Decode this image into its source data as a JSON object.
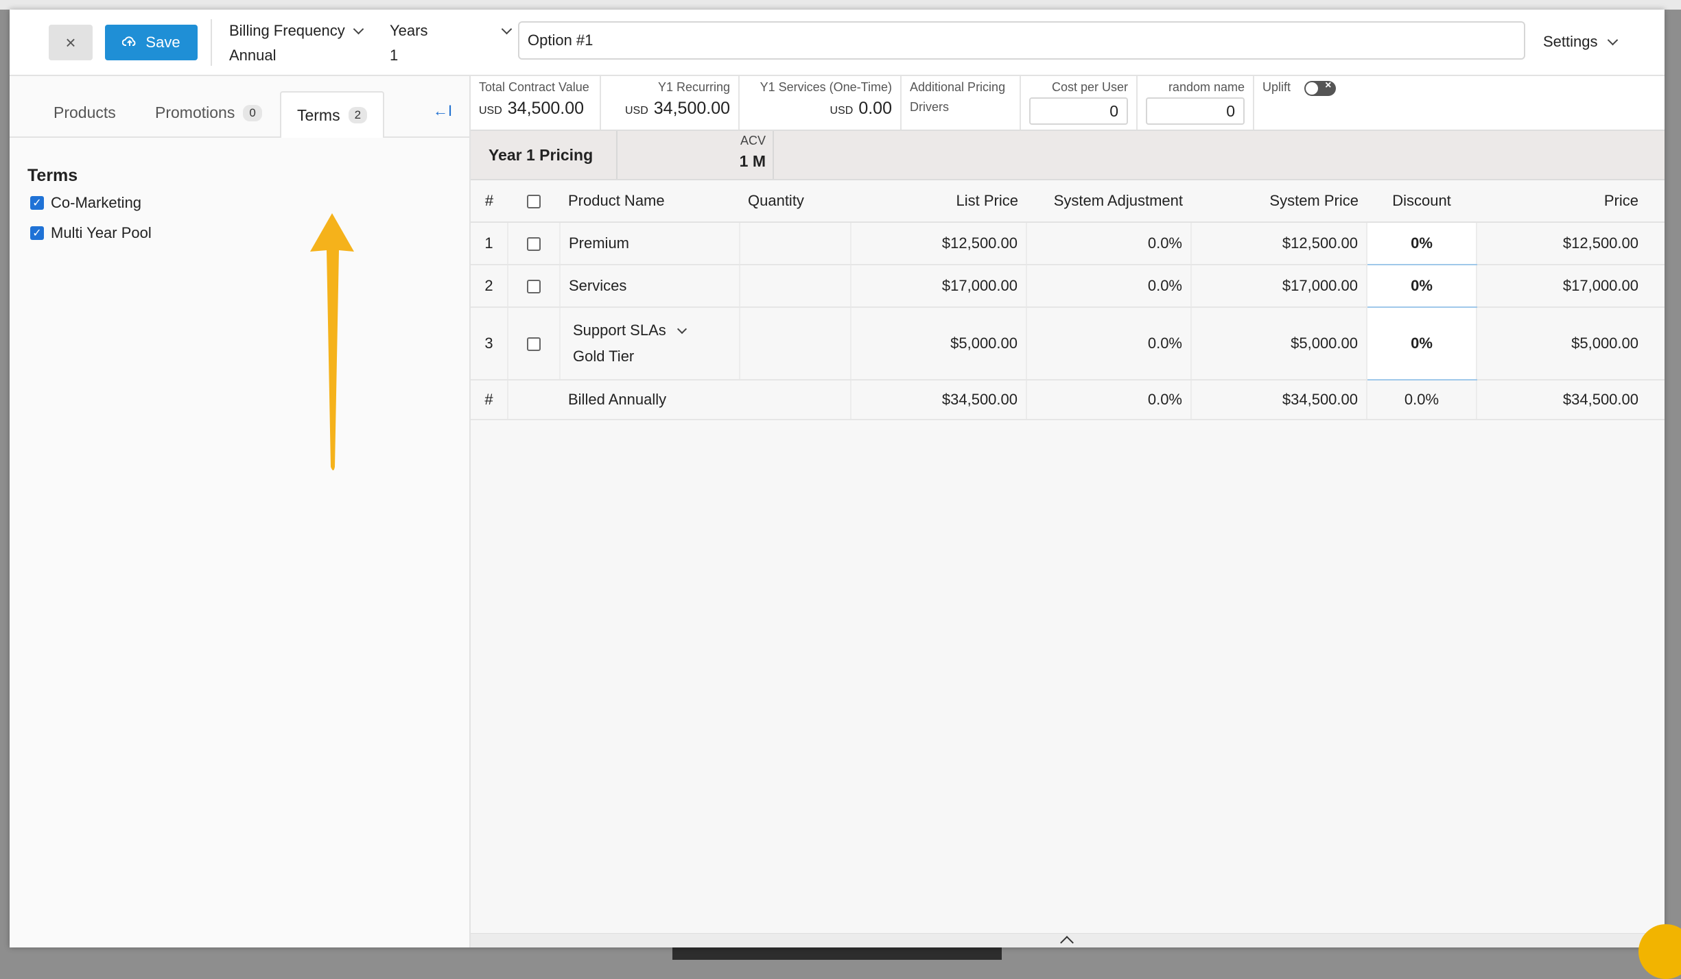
{
  "header": {
    "close_icon": "×",
    "save_label": "Save",
    "billing_frequency_label": "Billing Frequency",
    "billing_frequency_value": "Annual",
    "years_label": "Years",
    "years_value": "1",
    "option_name": "Option #1",
    "settings_label": "Settings"
  },
  "sidebar": {
    "tabs": [
      {
        "label": "Products"
      },
      {
        "label": "Promotions",
        "count": "0"
      },
      {
        "label": "Terms",
        "count": "2"
      }
    ],
    "active_tab": "Terms",
    "collapse_icon": "←I",
    "section_title": "Terms",
    "terms": [
      {
        "label": "Co-Marketing",
        "checked": true
      },
      {
        "label": "Multi Year Pool",
        "checked": true
      }
    ]
  },
  "metrics": {
    "tcv_label": "Total Contract Value",
    "tcv_currency": "USD",
    "tcv_value": "34,500.00",
    "y1_recurring_label": "Y1 Recurring",
    "y1_recurring_currency": "USD",
    "y1_recurring_value": "34,500.00",
    "y1_services_label": "Y1 Services (One-Time)",
    "y1_services_currency": "USD",
    "y1_services_value": "0.00",
    "additional_label_1": "Additional Pricing",
    "additional_label_2": "Drivers",
    "cost_per_user_label": "Cost per User",
    "cost_per_user_value": "0",
    "random_name_label": "random name",
    "random_name_value": "0",
    "uplift_label": "Uplift"
  },
  "year_band": {
    "title": "Year 1 Pricing",
    "acv_label": "ACV",
    "acv_value": "1 M"
  },
  "table": {
    "headers": {
      "num": "#",
      "product": "Product Name",
      "quantity": "Quantity",
      "list_price": "List Price",
      "adjustment": "System Adjustment",
      "system_price": "System Price",
      "discount": "Discount",
      "price": "Price"
    },
    "rows": [
      {
        "num": "1",
        "product": "Premium",
        "sub": "",
        "quantity": "",
        "list_price": "$12,500.00",
        "adjustment": "0.0%",
        "system_price": "$12,500.00",
        "discount": "0%",
        "price": "$12,500.00"
      },
      {
        "num": "2",
        "product": "Services",
        "sub": "",
        "quantity": "",
        "list_price": "$17,000.00",
        "adjustment": "0.0%",
        "system_price": "$17,000.00",
        "discount": "0%",
        "price": "$17,000.00"
      },
      {
        "num": "3",
        "product": "Support SLAs",
        "sub": "Gold Tier",
        "quantity": "",
        "list_price": "$5,000.00",
        "adjustment": "0.0%",
        "system_price": "$5,000.00",
        "discount": "0%",
        "price": "$5,000.00"
      }
    ],
    "footer": {
      "num": "#",
      "label": "Billed Annually",
      "list_price": "$34,500.00",
      "adjustment": "0.0%",
      "system_price": "$34,500.00",
      "discount": "0.0%",
      "price": "$34,500.00"
    }
  },
  "colors": {
    "save_button": "#1f8fd6",
    "checkbox_checked": "#1f72d6",
    "annotation_arrow": "#f5b21b"
  }
}
